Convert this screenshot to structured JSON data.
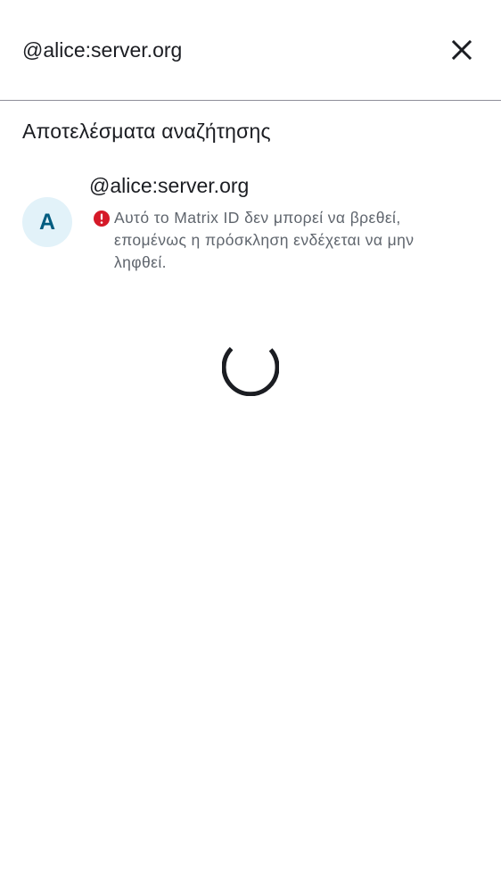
{
  "search": {
    "query": "@alice:server.org",
    "close_icon": "close-icon"
  },
  "results": {
    "title": "Αποτελέσματα αναζήτησης",
    "items": [
      {
        "avatar_letter": "A",
        "name": "@alice:server.org",
        "warning_icon": "error-icon",
        "warning": "Αυτό το Matrix ID δεν μπορεί να βρεθεί, επομένως η πρόσκληση ενδέχεται να μην ληφθεί."
      }
    ]
  },
  "loading": {
    "icon": "loading-spinner"
  },
  "colors": {
    "text_primary": "#1b1d22",
    "text_secondary": "#5f656d",
    "error": "#d51928",
    "avatar_bg": "#e2f2f9",
    "avatar_fg": "#005c80",
    "divider": "#8f8f99"
  }
}
